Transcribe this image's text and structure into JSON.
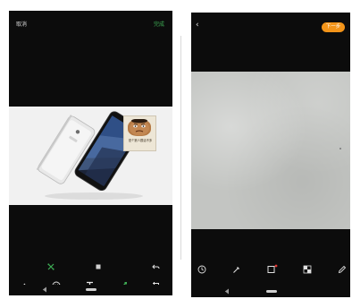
{
  "left_screen": {
    "header": {
      "cancel_label": "取消",
      "done_label": "完成"
    },
    "sticker": {
      "caption": "是个狼人狠话不多"
    },
    "tools_row_1": [
      "crop-icon",
      "square-icon",
      "undo-icon"
    ],
    "tools_row_2": [
      "pen-icon",
      "emoji-icon",
      "text-icon",
      "mosaic-icon",
      "crop-rotate-icon"
    ],
    "nav": [
      "nav-back-icon",
      "nav-home-pill"
    ]
  },
  "right_screen": {
    "header": {
      "back_label": "‹",
      "next_label": "下一步"
    },
    "tools": [
      "clock-icon",
      "brush-icon",
      "rectangle-icon",
      "mosaic-icon",
      "pencil-icon"
    ],
    "accent_color": "#f39419",
    "nav": [
      "nav-back-icon",
      "nav-home-pill"
    ]
  },
  "colors": {
    "done_green": "#3fae55",
    "next_orange": "#f39419",
    "selected_red_dot": "#e53935"
  }
}
